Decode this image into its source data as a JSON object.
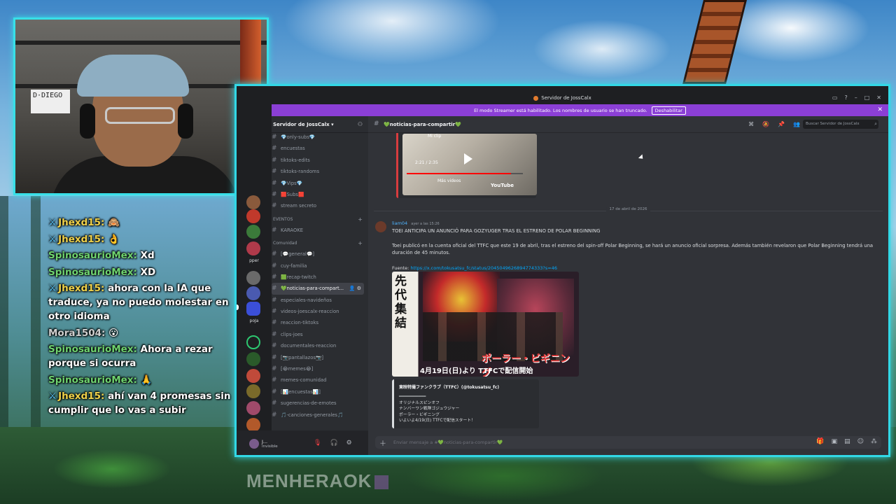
{
  "overlay": {
    "watermark": "MENHERAOK",
    "chat": [
      {
        "user": "Jhexd15:",
        "text": "🙈",
        "color": "yellow",
        "badge": true
      },
      {
        "user": "Jhexd15:",
        "text": "👌",
        "color": "yellow",
        "badge": true
      },
      {
        "user": "SpinosaurioMex:",
        "text": "Xd",
        "color": "green",
        "badge": false
      },
      {
        "user": "SpinosaurioMex:",
        "text": "XD",
        "color": "green",
        "badge": false
      },
      {
        "user": "Jhexd15:",
        "text": "ahora con la IA que traduce, ya no puedo molestar en otro idioma",
        "color": "yellow",
        "badge": true
      },
      {
        "user": "Mora1504:",
        "text": "😮",
        "color": "gray",
        "badge": false
      },
      {
        "user": "SpinosaurioMex:",
        "text": "Ahora a rezar porque si ocurra",
        "color": "green",
        "badge": false
      },
      {
        "user": "SpinosaurioMex:",
        "text": "🙏",
        "color": "green",
        "badge": false
      },
      {
        "user": "Jhexd15:",
        "text": "ahí van 4 promesas sin cumplir que lo vas a subir",
        "color": "yellow",
        "badge": true
      }
    ],
    "webcam": {
      "sign_text": "D·DIEGO"
    }
  },
  "window": {
    "title": "Servidor de JossCalx",
    "streamer_notice": "El modo Streamer está habilitado. Los nombres de usuario se han truncado.",
    "streamer_button": "Deshabilitar",
    "server_name": "Servidor de JossCalx",
    "channel_header": "💚noticias-para-compartir💚",
    "search_placeholder": "Buscar Servidor de JossCalx",
    "composer_placeholder": "Enviar mensaje a #💚noticias-para-compartir💚",
    "rail_labels": {
      "pper": "pper",
      "poja": "poJa"
    },
    "channels_top": [
      {
        "label": "💎only-subs💎"
      },
      {
        "label": "encuestas"
      },
      {
        "label": "tiktoks-edits"
      },
      {
        "label": "tiktoks-randoms"
      },
      {
        "label": "💎Vips💎"
      },
      {
        "label": "🟥Subs🟥"
      },
      {
        "label": "stream secreto"
      }
    ],
    "category_events": "EVENTOS",
    "event_channel": "KARAOKE",
    "category_community": "Comunidad",
    "channels_community": [
      {
        "label": "[💬general💬]"
      },
      {
        "label": "cuy-familia"
      },
      {
        "label": "🟩recap-twitch"
      },
      {
        "label": "💚noticias-para-compart...",
        "active": true
      },
      {
        "label": "especiales-navideños"
      },
      {
        "label": "videos-joescalx-reaccion"
      },
      {
        "label": "reaccion-tiktoks"
      },
      {
        "label": "clips-joes"
      },
      {
        "label": "documentales-reaccion"
      },
      {
        "label": "[📷pantallazos📷]"
      },
      {
        "label": "[😂memes😂]"
      },
      {
        "label": "memes-comunidad"
      },
      {
        "label": "[📊encuestas📊]"
      },
      {
        "label": "sugerencias-de-emotes"
      },
      {
        "label": "🎵-canciones-generales🎵"
      }
    ],
    "user": {
      "name": "J...",
      "status": "Invisible"
    }
  },
  "messages": {
    "clip_label": "Mi clip",
    "clip_time": "2:21 / 2:35",
    "clip_more": "Más videos",
    "clip_logo": "YouTube",
    "clip_progress": 0.9,
    "date_divider": "17 de abril de 2026",
    "post": {
      "author": "liam04",
      "timestamp": "ayer a las 15:26",
      "title": "TOEI ANTICIPA UN ANUNCIÓ PARA GOZYUGER TRAS EL ESTRENO DE POLAR BEGINNING",
      "body": "Toei publicó en la cuenta oficial del TTFC que este 19 de abril, tras el estreno del spin-off Polar Beginning, se hará un anuncio oficial sorpresa. Además también revelaron que Polar Beginning tendrá una duración de 45 minutos.",
      "source_label": "Fuente:",
      "source_url": "https://x.com/tokusatsu_fc/status/2045049626894774333?s=46",
      "poster_kanji": "先代集結",
      "poster_title": "ポーラー・ビギニング",
      "poster_date": "4月19日(日)より TTFCで配信開始"
    },
    "tweet": {
      "author": "東映特撮ファンクラブ（TTFC）(@tokusatsu_fc)",
      "lines": [
        "━━━━━━━━━━━",
        "オリジナルスピンオフ",
        "ナンバーワン戦隊ゴジュウジャー",
        "ポーラー・ビギニング",
        "いよいよ4/19(日) TTFCで配信スタート！"
      ]
    }
  },
  "colors": {
    "accent_border": "#32d8e6",
    "streamer_bar": "#8b3fd6",
    "link": "#00a8fc",
    "author": "#4fb4ff"
  }
}
